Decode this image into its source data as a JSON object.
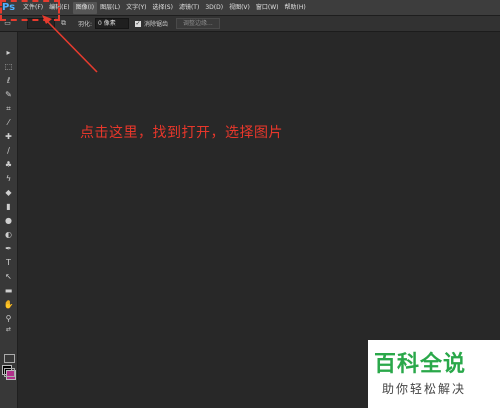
{
  "app": {
    "logo": "Ps"
  },
  "menu": {
    "items": [
      "文件(F)",
      "编辑(E)",
      "图像(I)",
      "图层(L)",
      "文字(Y)",
      "选择(S)",
      "滤镜(T)",
      "3D(D)",
      "视图(V)",
      "窗口(W)",
      "帮助(H)"
    ],
    "active_index": 2
  },
  "options": {
    "feather_label": "羽化:",
    "feather_value": "0 像素",
    "antialias_label": "消除锯齿",
    "refine_edge_label": "调整边缘..."
  },
  "annotation": {
    "text": "点击这里，找到打开，选择图片",
    "color": "#e8372b"
  },
  "watermark": {
    "line1": "百科全说",
    "line2": "助你轻松解决"
  },
  "colors": {
    "foreground": "#000000",
    "background": "#b0308a"
  }
}
